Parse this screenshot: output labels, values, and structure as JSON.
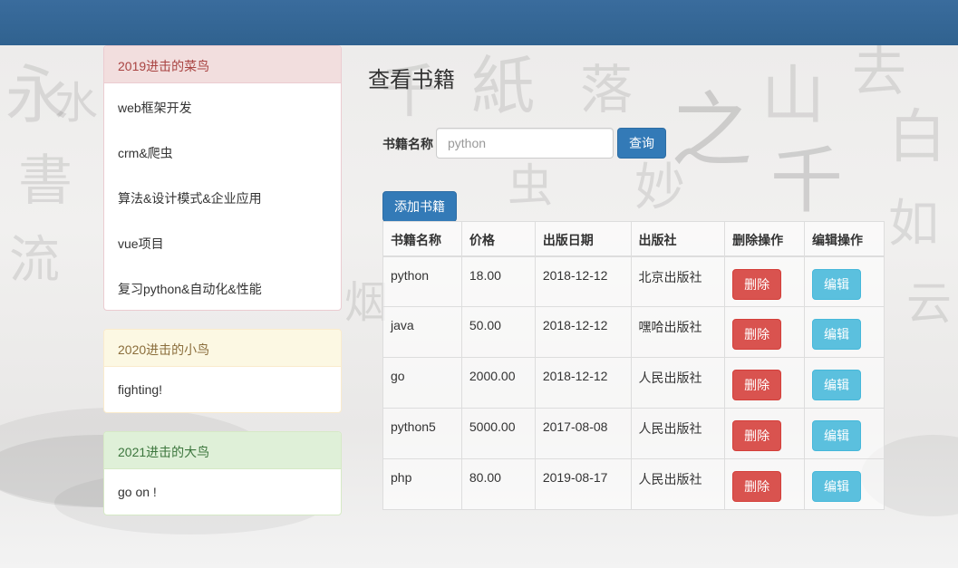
{
  "colors": {
    "topbar": "#336699",
    "primary": "#337ab7",
    "danger": "#d9534f",
    "info": "#5bc0de"
  },
  "sidebar": {
    "panel_2019": {
      "title": "2019进击的菜鸟",
      "items": [
        "web框架开发",
        "crm&爬虫",
        "算法&设计模式&企业应用",
        "vue项目",
        "复习python&自动化&性能"
      ]
    },
    "panel_2020": {
      "title": "2020进击的小鸟",
      "body": "fighting!"
    },
    "panel_2021": {
      "title": "2021进击的大鸟",
      "body": "go on !"
    }
  },
  "main": {
    "title": "查看书籍",
    "search": {
      "label": "书籍名称",
      "placeholder": "python",
      "button": "查询"
    },
    "add_button": "添加书籍",
    "table": {
      "headers": [
        "书籍名称",
        "价格",
        "出版日期",
        "出版社",
        "删除操作",
        "编辑操作"
      ],
      "delete_label": "删除",
      "edit_label": "编辑",
      "rows": [
        [
          "python",
          "18.00",
          "2018-12-12",
          "北京出版社"
        ],
        [
          "java",
          "50.00",
          "2018-12-12",
          "嘿哈出版社"
        ],
        [
          "go",
          "2000.00",
          "2018-12-12",
          "人民出版社"
        ],
        [
          "python5",
          "5000.00",
          "2017-08-08",
          "人民出版社"
        ],
        [
          "php",
          "80.00",
          "2019-08-17",
          "人民出版社"
        ]
      ]
    }
  }
}
